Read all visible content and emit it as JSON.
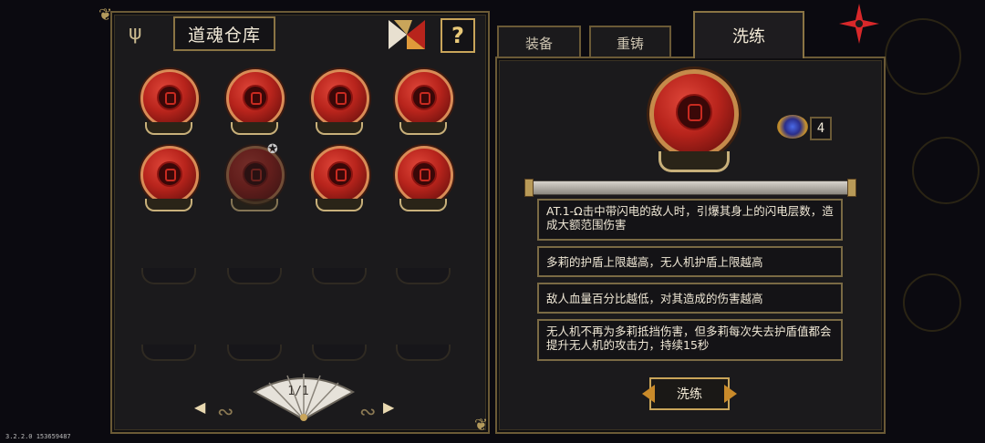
{
  "warehouse": {
    "title": "道魂仓库",
    "help_label": "?",
    "page_indicator": "1/1",
    "prev_arrow": "◀",
    "next_arrow": "▶"
  },
  "tabs": [
    {
      "label": "装备"
    },
    {
      "label": "重铸"
    },
    {
      "label": "洗练"
    }
  ],
  "detail": {
    "count": "4",
    "affixes": [
      "AT.1-Ω击中带闪电的敌人时，引爆其身上的闪电层数，造成大额范围伤害",
      "多莉的护盾上限越高，无人机护盾上限越高",
      "敌人血量百分比越低，对其造成的伤害越高",
      "无人机不再为多莉抵挡伤害，但多莉每次失去护盾值都会提升无人机的攻击力，持续15秒"
    ],
    "refine_button": "洗练"
  },
  "version": "3.2.2.0 153659487",
  "colors": {
    "orb_red": "#b8241c",
    "frame_gold": "#c9a55a",
    "panel_bg": "#1b1a1c"
  }
}
